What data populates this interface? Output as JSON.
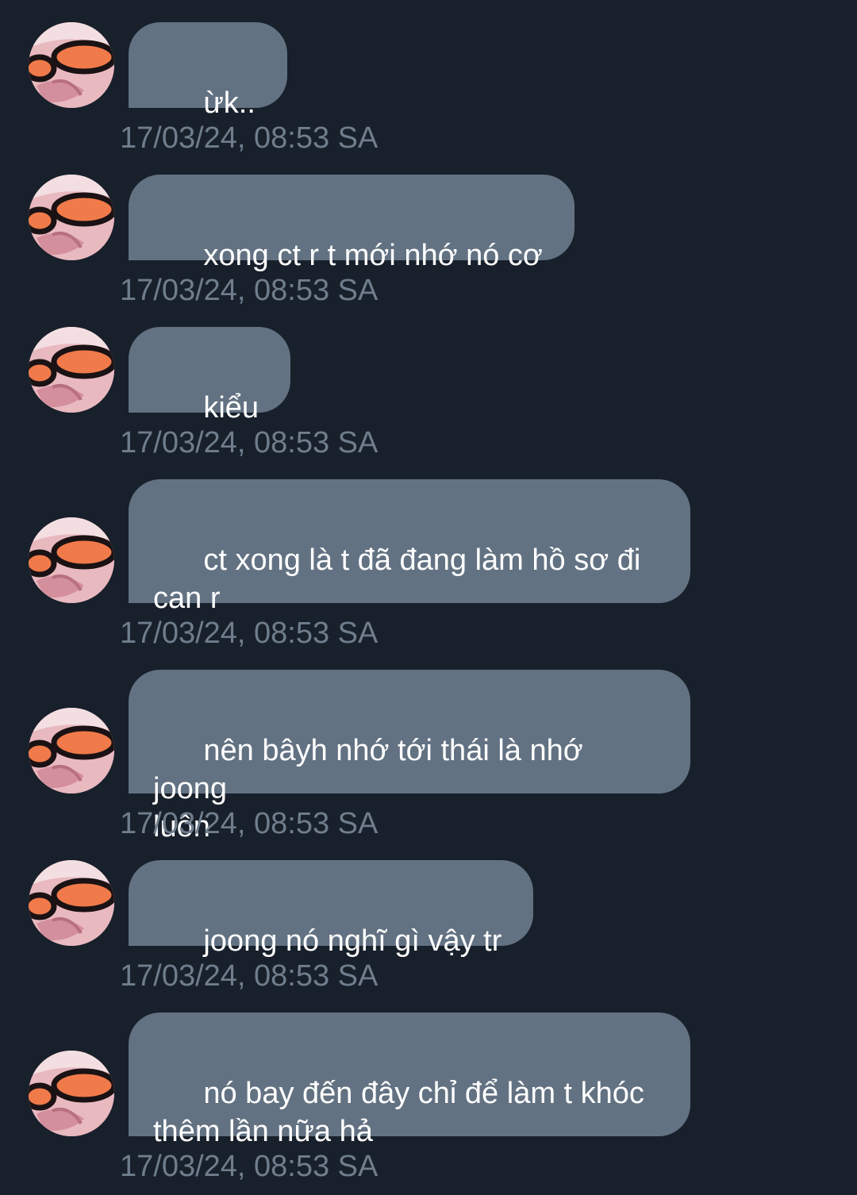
{
  "messages": [
    {
      "text": "ừk..",
      "timestamp": "17/03/24, 08:53 SA"
    },
    {
      "text": "xong ct r t mới nhớ nó cơ",
      "timestamp": "17/03/24, 08:53 SA"
    },
    {
      "text": "kiểu",
      "timestamp": "17/03/24, 08:53 SA"
    },
    {
      "text": "ct xong là t đã đang làm hồ sơ đi\ncan r",
      "timestamp": "17/03/24, 08:53 SA"
    },
    {
      "text": "nên bâyh nhớ tới thái là nhớ joong\nluôn",
      "timestamp": "17/03/24, 08:53 SA"
    },
    {
      "text": "joong nó nghĩ gì vậy tr",
      "timestamp": "17/03/24, 08:53 SA"
    },
    {
      "text": "nó bay đến đây chỉ để làm t khóc\nthêm lần nữa hả",
      "timestamp": "17/03/24, 08:53 SA"
    }
  ],
  "colors": {
    "background": "#18202b",
    "bubble": "#637282",
    "bubble_text": "#ffffff",
    "timestamp": "#6f7d8c"
  },
  "icons": {
    "avatar": "avatar-sunglasses-photo"
  }
}
